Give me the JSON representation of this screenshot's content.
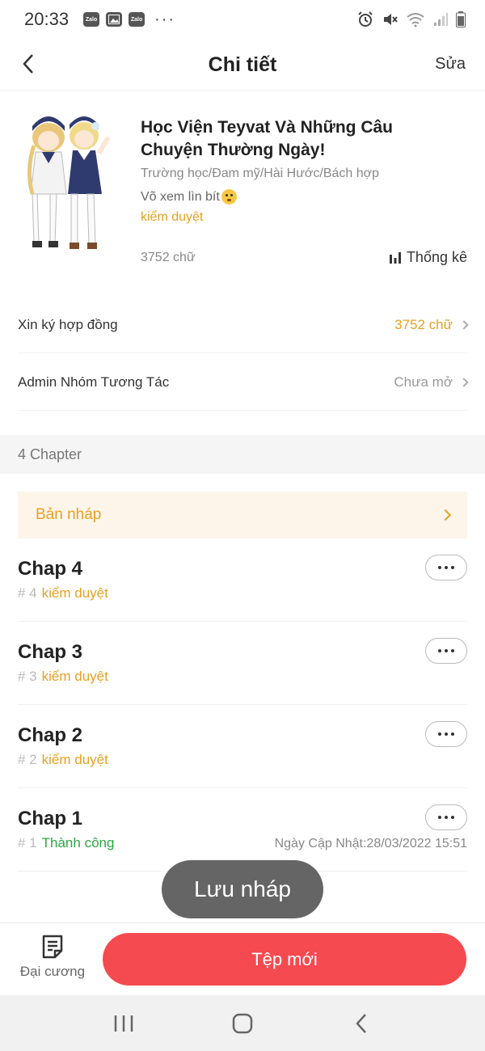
{
  "status_bar": {
    "time": "20:33",
    "notification_icons": [
      "zalo-icon",
      "gallery-icon",
      "zalo-icon"
    ],
    "overflow": "···",
    "right_icons": [
      "alarm-icon",
      "mute-icon",
      "wifi-icon",
      "signal-icon",
      "battery-icon"
    ]
  },
  "header": {
    "title": "Chi tiết",
    "edit_label": "Sửa"
  },
  "book": {
    "title": "Học Viện Teyvat Và Những Câu Chuyện Thường Ngày!",
    "genres": "Trường học/Đam mỹ/Hài Hước/Bách hợp",
    "description": "Võ xem lìn bít",
    "status": "kiểm duyệt",
    "word_count": "3752 chữ",
    "stats_label": "Thống kê"
  },
  "rows": [
    {
      "label": "Xin ký hợp đồng",
      "value": "3752 chữ",
      "value_color": "#e6a123"
    },
    {
      "label": "Admin Nhóm Tương Tác",
      "value": "Chưa mở",
      "value_color": "#999999"
    }
  ],
  "chapters_section": {
    "count_label": "4 Chapter",
    "draft_label": "Bản nháp",
    "items": [
      {
        "title": "Chap 4",
        "num": "# 4",
        "status": "kiểm duyệt",
        "status_color": "#e6a123",
        "date": ""
      },
      {
        "title": "Chap 3",
        "num": "# 3",
        "status": "kiểm duyệt",
        "status_color": "#e6a123",
        "date": ""
      },
      {
        "title": "Chap 2",
        "num": "# 2",
        "status": "kiểm duyệt",
        "status_color": "#e6a123",
        "date": ""
      },
      {
        "title": "Chap 1",
        "num": "# 1",
        "status": "Thành công",
        "status_color": "#2aa745",
        "date": "Ngày Cập Nhật:28/03/2022 15:51"
      }
    ]
  },
  "toast": "Lưu nháp",
  "bottom": {
    "outline_label": "Đại cương",
    "new_button_label": "Tệp mới"
  },
  "colors": {
    "accent": "#e6a123",
    "primary_button": "#f54a4f",
    "success": "#2aa745"
  }
}
